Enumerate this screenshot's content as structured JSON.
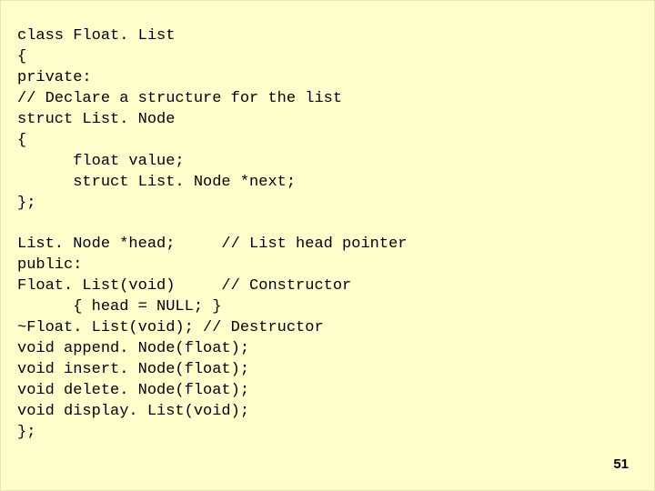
{
  "page_number": "51",
  "code": {
    "l01": "class Float. List",
    "l02": "{",
    "l03": "private:",
    "l04": "// Declare a structure for the list",
    "l05": "struct List. Node",
    "l06": "{",
    "l07": "      float value;",
    "l08": "      struct List. Node *next;",
    "l09": "};",
    "l10": "",
    "l11": "List. Node *head;     // List head pointer",
    "l12": "public:",
    "l13": "Float. List(void)     // Constructor",
    "l14": "      { head = NULL; }",
    "l15": "~Float. List(void); // Destructor",
    "l16": "void append. Node(float);",
    "l17": "void insert. Node(float);",
    "l18": "void delete. Node(float);",
    "l19": "void display. List(void);",
    "l20": "};"
  }
}
